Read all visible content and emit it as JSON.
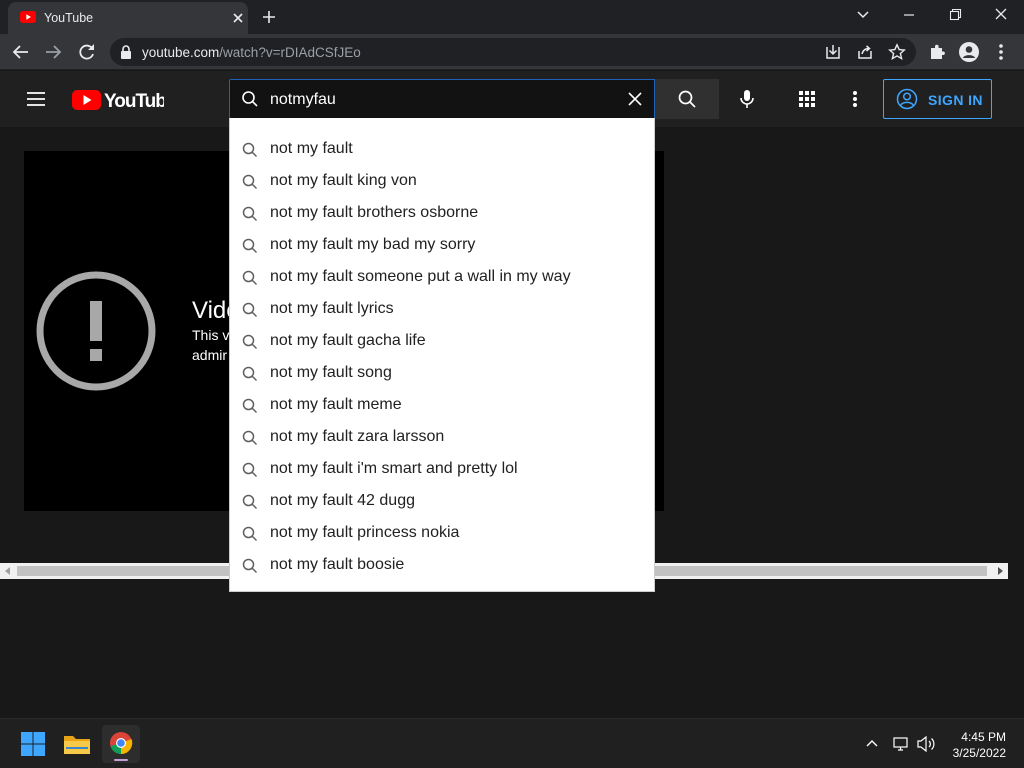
{
  "browser": {
    "tab": {
      "title": "YouTube"
    },
    "url": {
      "host": "youtube.com",
      "path": "/watch?v=rDIAdCSfJEo"
    }
  },
  "youtube": {
    "logo_text": "YouTube",
    "search": {
      "value": "notmyfau"
    },
    "sign_in_label": "SIGN IN",
    "player": {
      "title": "Vide",
      "message_line1": "This v",
      "message_line2": "admir"
    },
    "suggestions": [
      "not my fault",
      "not my fault king von",
      "not my fault brothers osborne",
      "not my fault my bad my sorry",
      "not my fault someone put a wall in my way",
      "not my fault lyrics",
      "not my fault gacha life",
      "not my fault song",
      "not my fault meme",
      "not my fault zara larsson",
      "not my fault i'm smart and pretty lol",
      "not my fault 42 dugg",
      "not my fault princess nokia",
      "not my fault boosie"
    ]
  },
  "taskbar": {
    "apps": [
      "windows-start-icon",
      "file-explorer-icon",
      "chrome-icon"
    ],
    "time": "4:45 PM",
    "date": "3/25/2022"
  },
  "colors": {
    "yt_red": "#ff0000",
    "accent_blue": "#3ea6ff",
    "search_focus": "#1c62b9"
  }
}
